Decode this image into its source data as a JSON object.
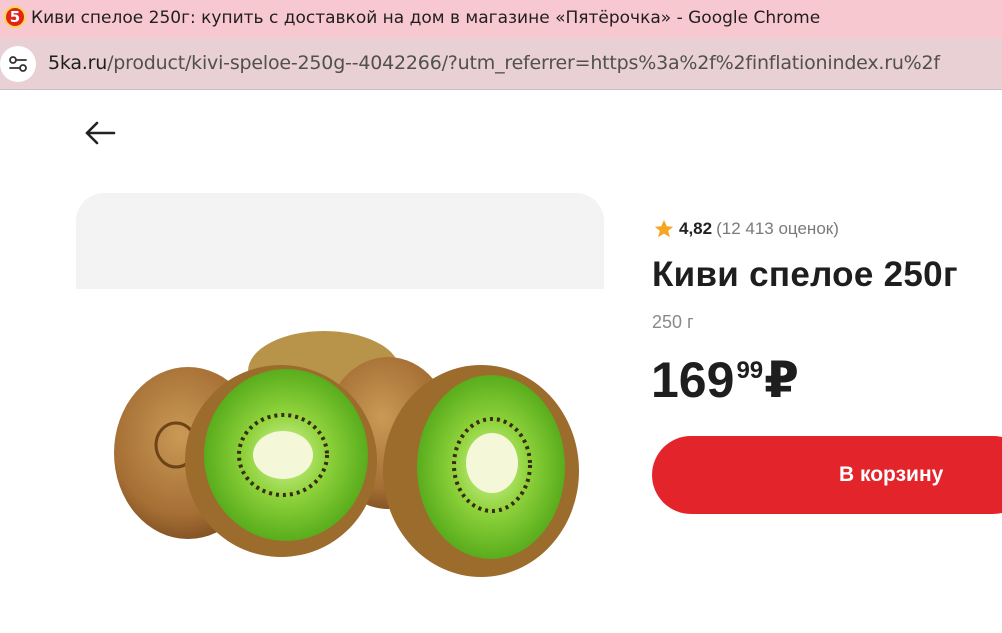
{
  "window": {
    "title": "Киви спелое 250г: купить с доставкой на дом в магазине «Пятёрочка» - Google Chrome",
    "favicon_text": "5"
  },
  "address_bar": {
    "host": "5ka.ru",
    "path": "/product/kivi-speloe-250g--4042266/?utm_referrer=https%3a%2f%2finflationindex.ru%2f"
  },
  "product": {
    "rating_score": "4,82",
    "rating_count": "(12 413 оценок)",
    "title": "Киви спелое 250г",
    "weight": "250 г",
    "price_rub": "169",
    "price_kop": "99",
    "currency": "₽",
    "add_to_cart_label": "В корзину"
  },
  "colors": {
    "accent": "#e3242b",
    "star": "#f5a623",
    "title_bar": "#f8c8d0"
  },
  "icons": [
    "site-info-icon",
    "back-arrow-icon",
    "star-icon"
  ]
}
